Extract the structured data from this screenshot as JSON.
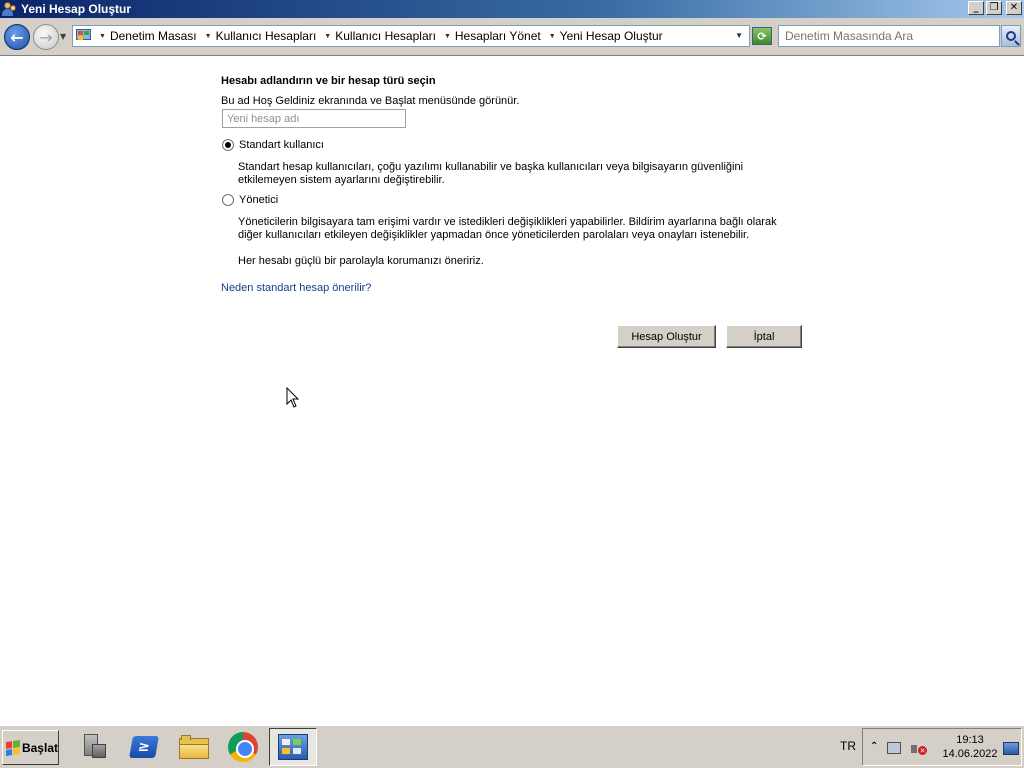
{
  "window": {
    "title": "Yeni Hesap Oluştur",
    "buttons": {
      "minimize": "_",
      "maximize": "❐",
      "close": "✕"
    }
  },
  "addressbar": {
    "breadcrumbs": [
      "Denetim Masası",
      "Kullanıcı Hesapları",
      "Kullanıcı Hesapları",
      "Hesapları Yönet",
      "Yeni Hesap Oluştur"
    ],
    "search_placeholder": "Denetim Masasında Ara"
  },
  "form": {
    "heading": "Hesabı adlandırın ve bir hesap türü seçin",
    "hint": "Bu ad Hoş Geldiniz ekranında ve Başlat menüsünde görünür.",
    "name_placeholder": "Yeni hesap adı",
    "name_value": "",
    "options": [
      {
        "label": "Standart kullanıcı",
        "checked": true,
        "description": "Standart hesap kullanıcıları, çoğu yazılımı kullanabilir ve başka kullanıcıları veya bilgisayarın güvenliğini etkilemeyen sistem ayarlarını değiştirebilir."
      },
      {
        "label": "Yönetici",
        "checked": false,
        "description": "Yöneticilerin bilgisayara tam erişimi vardır ve istedikleri değişiklikleri yapabilirler. Bildirim ayarlarına bağlı olarak diğer kullanıcıları etkileyen değişiklikler yapmadan önce yöneticilerden parolaları veya onayları istenebilir."
      }
    ],
    "recommendation": "Her hesabı güçlü bir parolayla korumanızı öneririz.",
    "link": "Neden standart hesap önerilir?",
    "create_button": "Hesap Oluştur",
    "cancel_button": "İptal"
  },
  "taskbar": {
    "start_label": "Başlat",
    "apps": [
      "server-manager-icon",
      "powershell-icon",
      "file-explorer-icon",
      "chrome-icon",
      "control-panel-icon"
    ],
    "active_app": "control-panel-icon",
    "language": "TR",
    "time": "19:13",
    "date": "14.06.2022"
  },
  "colors": {
    "titlebar_start": "#0a246a",
    "titlebar_end": "#a6caf0",
    "link": "#1a3c8c",
    "chrome_face": "#d4d0c8"
  }
}
